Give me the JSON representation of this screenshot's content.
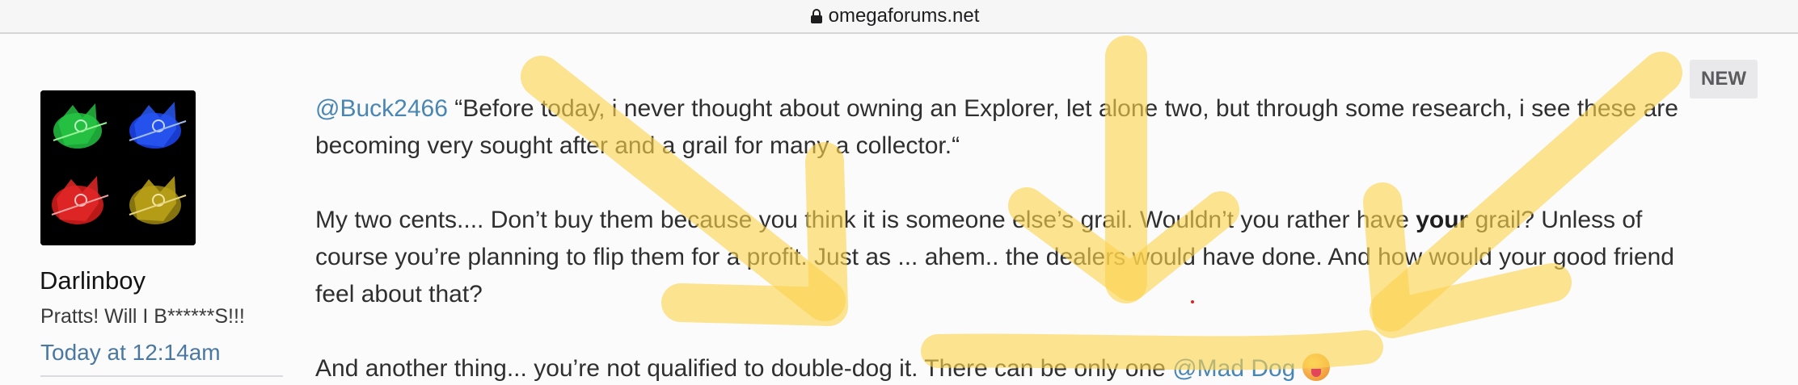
{
  "browser": {
    "domain": "omegaforums.net",
    "icon": "lock-icon"
  },
  "user": {
    "name": "Darlinboy",
    "title": "Pratts! Will I B******S!!!",
    "post_time": "Today at 12:14am",
    "avatar_icon": "avatar-image"
  },
  "post": {
    "badge": "NEW",
    "p1_mention": "@Buck2466",
    "p1_text": " “Before today, i never thought about owning an Explorer, let alone two, but through some research, i see these are becoming very sought after and a grail for many a collector.“",
    "p2_a": "My two cents.... Don’t buy them because you think it is someone else’s grail. Wouldn’t you rather have ",
    "p2_bold": "your",
    "p2_b": " grail? Unless of course you’re planning to flip them for a profit. Just as ... ahem.. the dealers would have done. And how would your good friend feel about that?",
    "p3_a": "And another thing... you’re not qualified to double-dog it. There can be only one ",
    "p3_mention": "@Mad Dog",
    "p3_emoji": "tongue-emoji"
  },
  "colors": {
    "highlighter": "#fcd34d",
    "mention": "#4a86b3",
    "time": "#4a78a0"
  }
}
